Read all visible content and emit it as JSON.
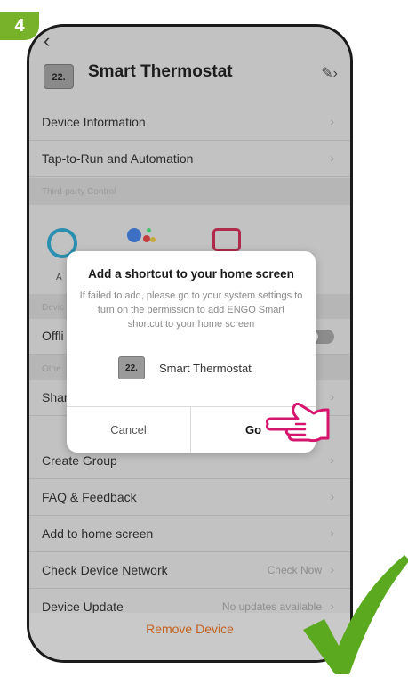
{
  "step_number": "4",
  "header": {
    "back_icon": "chevron-left-icon",
    "device_icon_text": "22.",
    "title": "Smart Thermostat"
  },
  "settings": {
    "device_information": "Device Information",
    "tap_to_run": "Tap-to-Run and Automation",
    "third_party_section": "Third-party Control",
    "alexa_label": "A",
    "device_section": "Devic",
    "offline_label": "Offli",
    "others_section": "Othe",
    "share_label": "Shar",
    "create_group": "Create Group",
    "faq": "FAQ & Feedback",
    "add_home": "Add to home screen",
    "check_network": "Check Device Network",
    "check_network_value": "Check Now",
    "device_update": "Device Update",
    "device_update_value": "No updates available",
    "remove_device": "Remove Device"
  },
  "dialog": {
    "title": "Add a shortcut to your home screen",
    "body": "If failed to add, please go to your system settings to turn on the permission to add ENGO Smart shortcut to your home screen",
    "device_icon_text": "22.",
    "device_name": "Smart Thermostat",
    "cancel_label": "Cancel",
    "go_label": "Go"
  },
  "colors": {
    "badge": "#78b22b",
    "checkmark": "#5aa91f",
    "hand": "#d6166e",
    "remove_text": "#c6621e"
  }
}
